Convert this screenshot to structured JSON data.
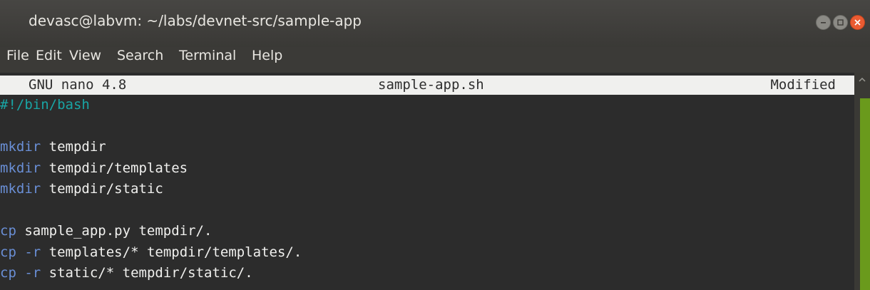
{
  "window": {
    "title": "devasc@labvm: ~/labs/devnet-src/sample-app"
  },
  "menubar": {
    "items": [
      "File",
      "Edit",
      "View",
      "Search",
      "Terminal",
      "Help"
    ]
  },
  "nano": {
    "version": "GNU nano 4.8",
    "filename": "sample-app.sh",
    "status": "Modified"
  },
  "file_lines": [
    {
      "segments": [
        {
          "text": "#!/bin/bash",
          "color": "teal"
        }
      ]
    },
    {
      "segments": []
    },
    {
      "segments": [
        {
          "text": "mkdir",
          "color": "blue"
        },
        {
          "text": " tempdir",
          "color": "white"
        }
      ]
    },
    {
      "segments": [
        {
          "text": "mkdir",
          "color": "blue"
        },
        {
          "text": " tempdir/templates",
          "color": "white"
        }
      ]
    },
    {
      "segments": [
        {
          "text": "mkdir",
          "color": "blue"
        },
        {
          "text": " tempdir/static",
          "color": "white"
        }
      ]
    },
    {
      "segments": []
    },
    {
      "segments": [
        {
          "text": "cp",
          "color": "blue"
        },
        {
          "text": " sample_app.py tempdir/.",
          "color": "white"
        }
      ]
    },
    {
      "segments": [
        {
          "text": "cp",
          "color": "blue"
        },
        {
          "text": " ",
          "color": "white"
        },
        {
          "text": "-r",
          "color": "blue"
        },
        {
          "text": " templates/* tempdir/templates/.",
          "color": "white"
        }
      ]
    },
    {
      "segments": [
        {
          "text": "cp",
          "color": "blue"
        },
        {
          "text": " ",
          "color": "white"
        },
        {
          "text": "-r",
          "color": "blue"
        },
        {
          "text": " static/* tempdir/static/.",
          "color": "white"
        }
      ]
    }
  ],
  "colors": {
    "terminal_bg": "#2c2c2c",
    "text": "#f0f0ee",
    "comment": "#19a5a5",
    "command": "#6a8fd6",
    "close_button": "#ea5b32",
    "scroll_thumb": "#6a9a1c"
  },
  "icons": {
    "minimize": "minimize-icon",
    "maximize": "maximize-icon",
    "close": "close-icon",
    "scroll_up": "scroll-up-arrow-icon"
  }
}
